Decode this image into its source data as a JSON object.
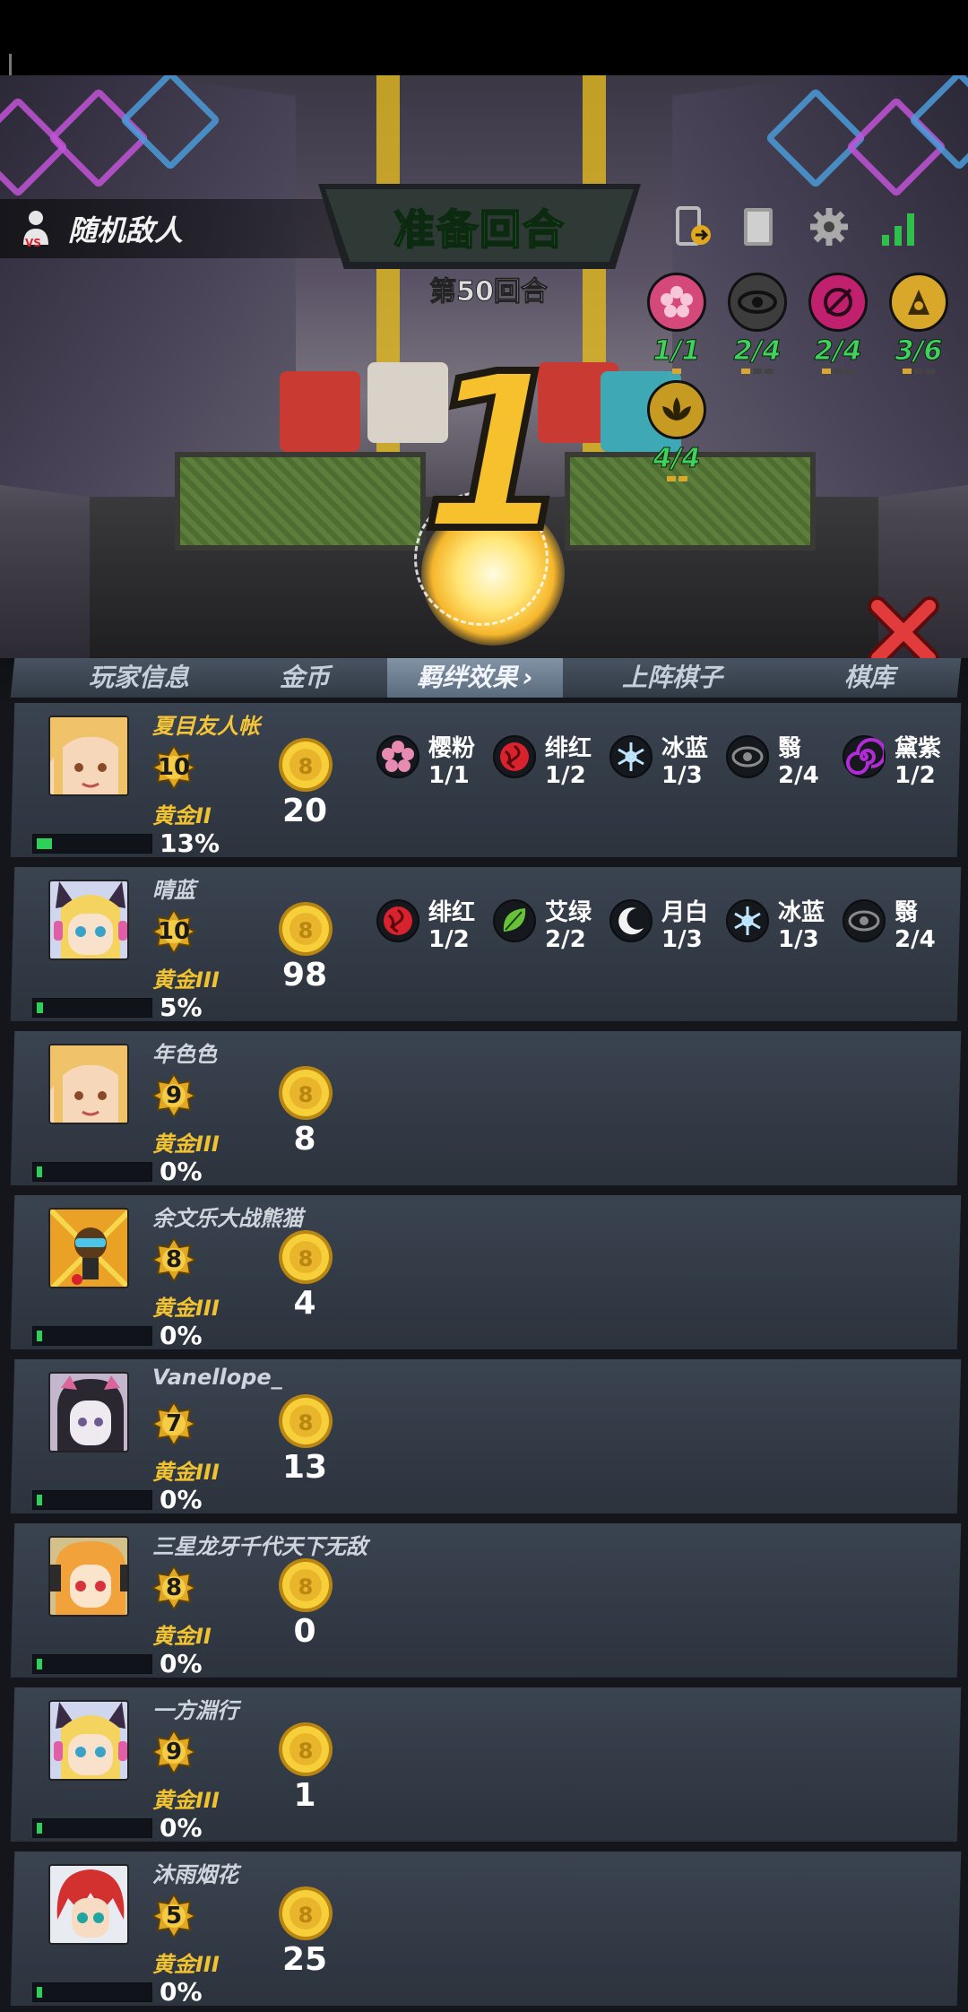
{
  "header": {
    "enemy_label": "随机敌人",
    "phase_title": "准备回合",
    "round_label": "第50回合",
    "countdown": "1"
  },
  "top_icons": [
    "phone-signal-icon",
    "book-icon",
    "gear-icon",
    "network-bars-icon"
  ],
  "synergies": [
    {
      "icon": "sakura-icon",
      "count": "1/1",
      "color": "#d4497a",
      "level": 1,
      "slots": 1
    },
    {
      "icon": "eye-icon",
      "count": "2/4",
      "color": "#3d3d3d",
      "level": 1,
      "slots": 3
    },
    {
      "icon": "slash-circle-icon",
      "count": "2/4",
      "color": "#c0206e",
      "level": 1,
      "slots": 3
    },
    {
      "icon": "hood-icon",
      "count": "3/6",
      "color": "#d9a82a",
      "level": 1,
      "slots": 3
    },
    {
      "icon": "lotus-icon",
      "count": "4/4",
      "color": "#c79a21",
      "level": 2,
      "slots": 2
    }
  ],
  "tabs": [
    {
      "label": "玩家信息",
      "active": false
    },
    {
      "label": "金币",
      "active": false
    },
    {
      "label": "羁绊效果",
      "active": true,
      "chevron": "›"
    },
    {
      "label": "上阵棋子",
      "active": false
    },
    {
      "label": "棋库",
      "active": false
    }
  ],
  "players": [
    {
      "name": "夏目友人帐",
      "me": true,
      "level": "10",
      "rank": "黄金II",
      "xp": "13%",
      "xp_fraction": 0.13,
      "gold": "20",
      "avatar": "blonde-girl",
      "synergies": [
        {
          "icon": "sakura-icon",
          "name": "樱粉",
          "count": "1/1",
          "color": "#e88bb2"
        },
        {
          "icon": "rose-icon",
          "name": "绯红",
          "count": "1/2",
          "color": "#d8222e"
        },
        {
          "icon": "snowflake-icon",
          "name": "冰蓝",
          "count": "1/3",
          "color": "#bfe6ff"
        },
        {
          "icon": "eye-icon",
          "name": "翳",
          "count": "2/4",
          "color": "#8b8b8b"
        },
        {
          "icon": "spiral-icon",
          "name": "黛紫",
          "count": "1/2",
          "color": "#b12bd6"
        }
      ]
    },
    {
      "name": "晴蓝",
      "me": false,
      "level": "10",
      "rank": "黄金III",
      "xp": "5%",
      "xp_fraction": 0.05,
      "gold": "98",
      "avatar": "cat-ear-girl",
      "synergies": [
        {
          "icon": "rose-icon",
          "name": "绯红",
          "count": "1/2",
          "color": "#d8222e"
        },
        {
          "icon": "leaf-icon",
          "name": "艾绿",
          "count": "2/2",
          "color": "#67c23a"
        },
        {
          "icon": "moon-icon",
          "name": "月白",
          "count": "1/3",
          "color": "#f2f2f2"
        },
        {
          "icon": "snowflake-icon",
          "name": "冰蓝",
          "count": "1/3",
          "color": "#bfe6ff"
        },
        {
          "icon": "eye-icon",
          "name": "翳",
          "count": "2/4",
          "color": "#8b8b8b"
        }
      ]
    },
    {
      "name": "年色色",
      "me": false,
      "level": "9",
      "rank": "黄金III",
      "xp": "0%",
      "xp_fraction": 0.0,
      "gold": "8",
      "avatar": "blonde-girl",
      "synergies": []
    },
    {
      "name": "余文乐大战熊猫",
      "me": false,
      "level": "8",
      "rank": "黄金III",
      "xp": "0%",
      "xp_fraction": 0.0,
      "gold": "4",
      "avatar": "monkey",
      "synergies": []
    },
    {
      "name": "Vanellope_",
      "me": false,
      "level": "7",
      "rank": "黄金III",
      "xp": "0%",
      "xp_fraction": 0.0,
      "gold": "13",
      "avatar": "hood-girl",
      "synergies": []
    },
    {
      "name": "三星龙牙千代天下无敌",
      "me": false,
      "level": "8",
      "rank": "黄金II",
      "xp": "0%",
      "xp_fraction": 0.0,
      "gold": "0",
      "avatar": "orange-girl",
      "synergies": []
    },
    {
      "name": "一方淵行",
      "me": false,
      "level": "9",
      "rank": "黄金III",
      "xp": "0%",
      "xp_fraction": 0.0,
      "gold": "1",
      "avatar": "cat-ear-girl",
      "synergies": []
    },
    {
      "name": "沐雨烟花",
      "me": false,
      "level": "5",
      "rank": "黄金III",
      "xp": "0%",
      "xp_fraction": 0.0,
      "gold": "25",
      "avatar": "red-hair-boy",
      "synergies": []
    }
  ]
}
